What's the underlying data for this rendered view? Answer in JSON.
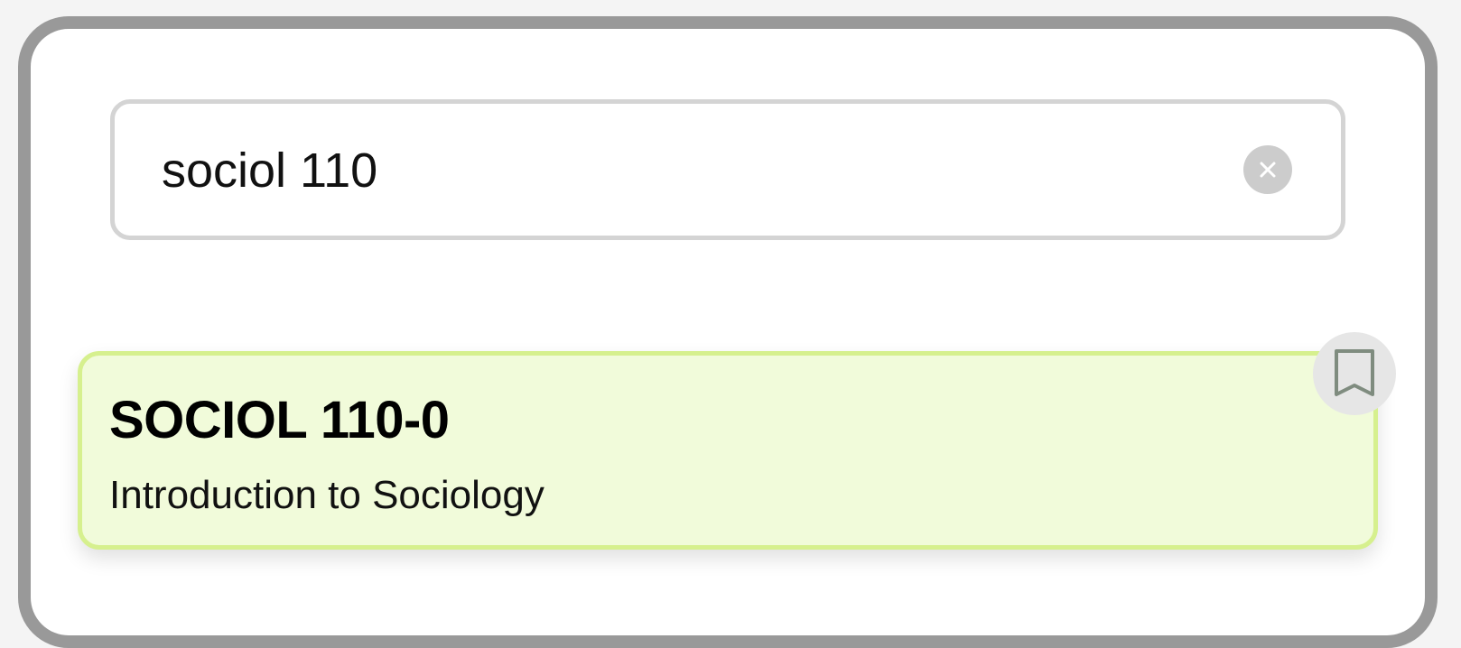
{
  "search": {
    "value": "sociol 110",
    "clear_icon": "close-icon"
  },
  "results": [
    {
      "code": "SOCIOL 110-0",
      "title": "Introduction to Sociology",
      "bookmark_icon": "bookmark-icon"
    }
  ],
  "colors": {
    "window_border": "#999999",
    "card_background": "#f1fbda",
    "card_border": "#d6f08e",
    "search_border": "#d4d4d4",
    "clear_button": "#cccccc",
    "bookmark_button": "#e6e6e6"
  }
}
